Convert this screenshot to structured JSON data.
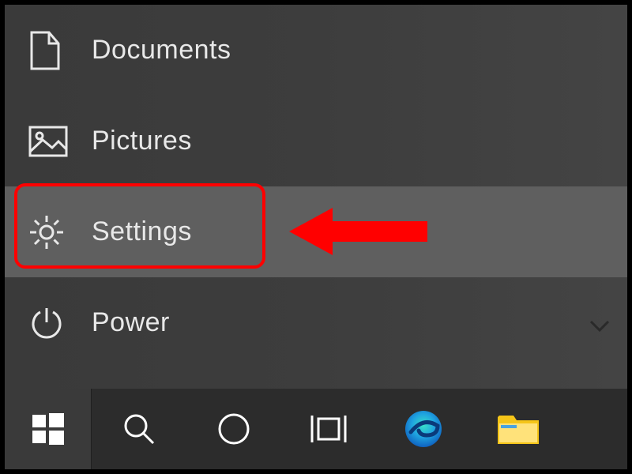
{
  "start_menu": {
    "items": [
      {
        "label": "Documents",
        "icon": "document-icon"
      },
      {
        "label": "Pictures",
        "icon": "pictures-icon"
      },
      {
        "label": "Settings",
        "icon": "gear-icon",
        "hover": true,
        "highlighted": true
      },
      {
        "label": "Power",
        "icon": "power-icon"
      }
    ]
  },
  "taskbar": {
    "items": [
      {
        "name": "start",
        "icon": "windows-logo-icon"
      },
      {
        "name": "search",
        "icon": "search-icon"
      },
      {
        "name": "cortana",
        "icon": "circle-icon"
      },
      {
        "name": "task-view",
        "icon": "task-view-icon"
      },
      {
        "name": "edge",
        "icon": "edge-icon"
      },
      {
        "name": "file-explorer",
        "icon": "file-explorer-icon"
      }
    ]
  },
  "annotation": {
    "arrow_color": "#ff0000",
    "highlight_color": "#ff0000"
  }
}
